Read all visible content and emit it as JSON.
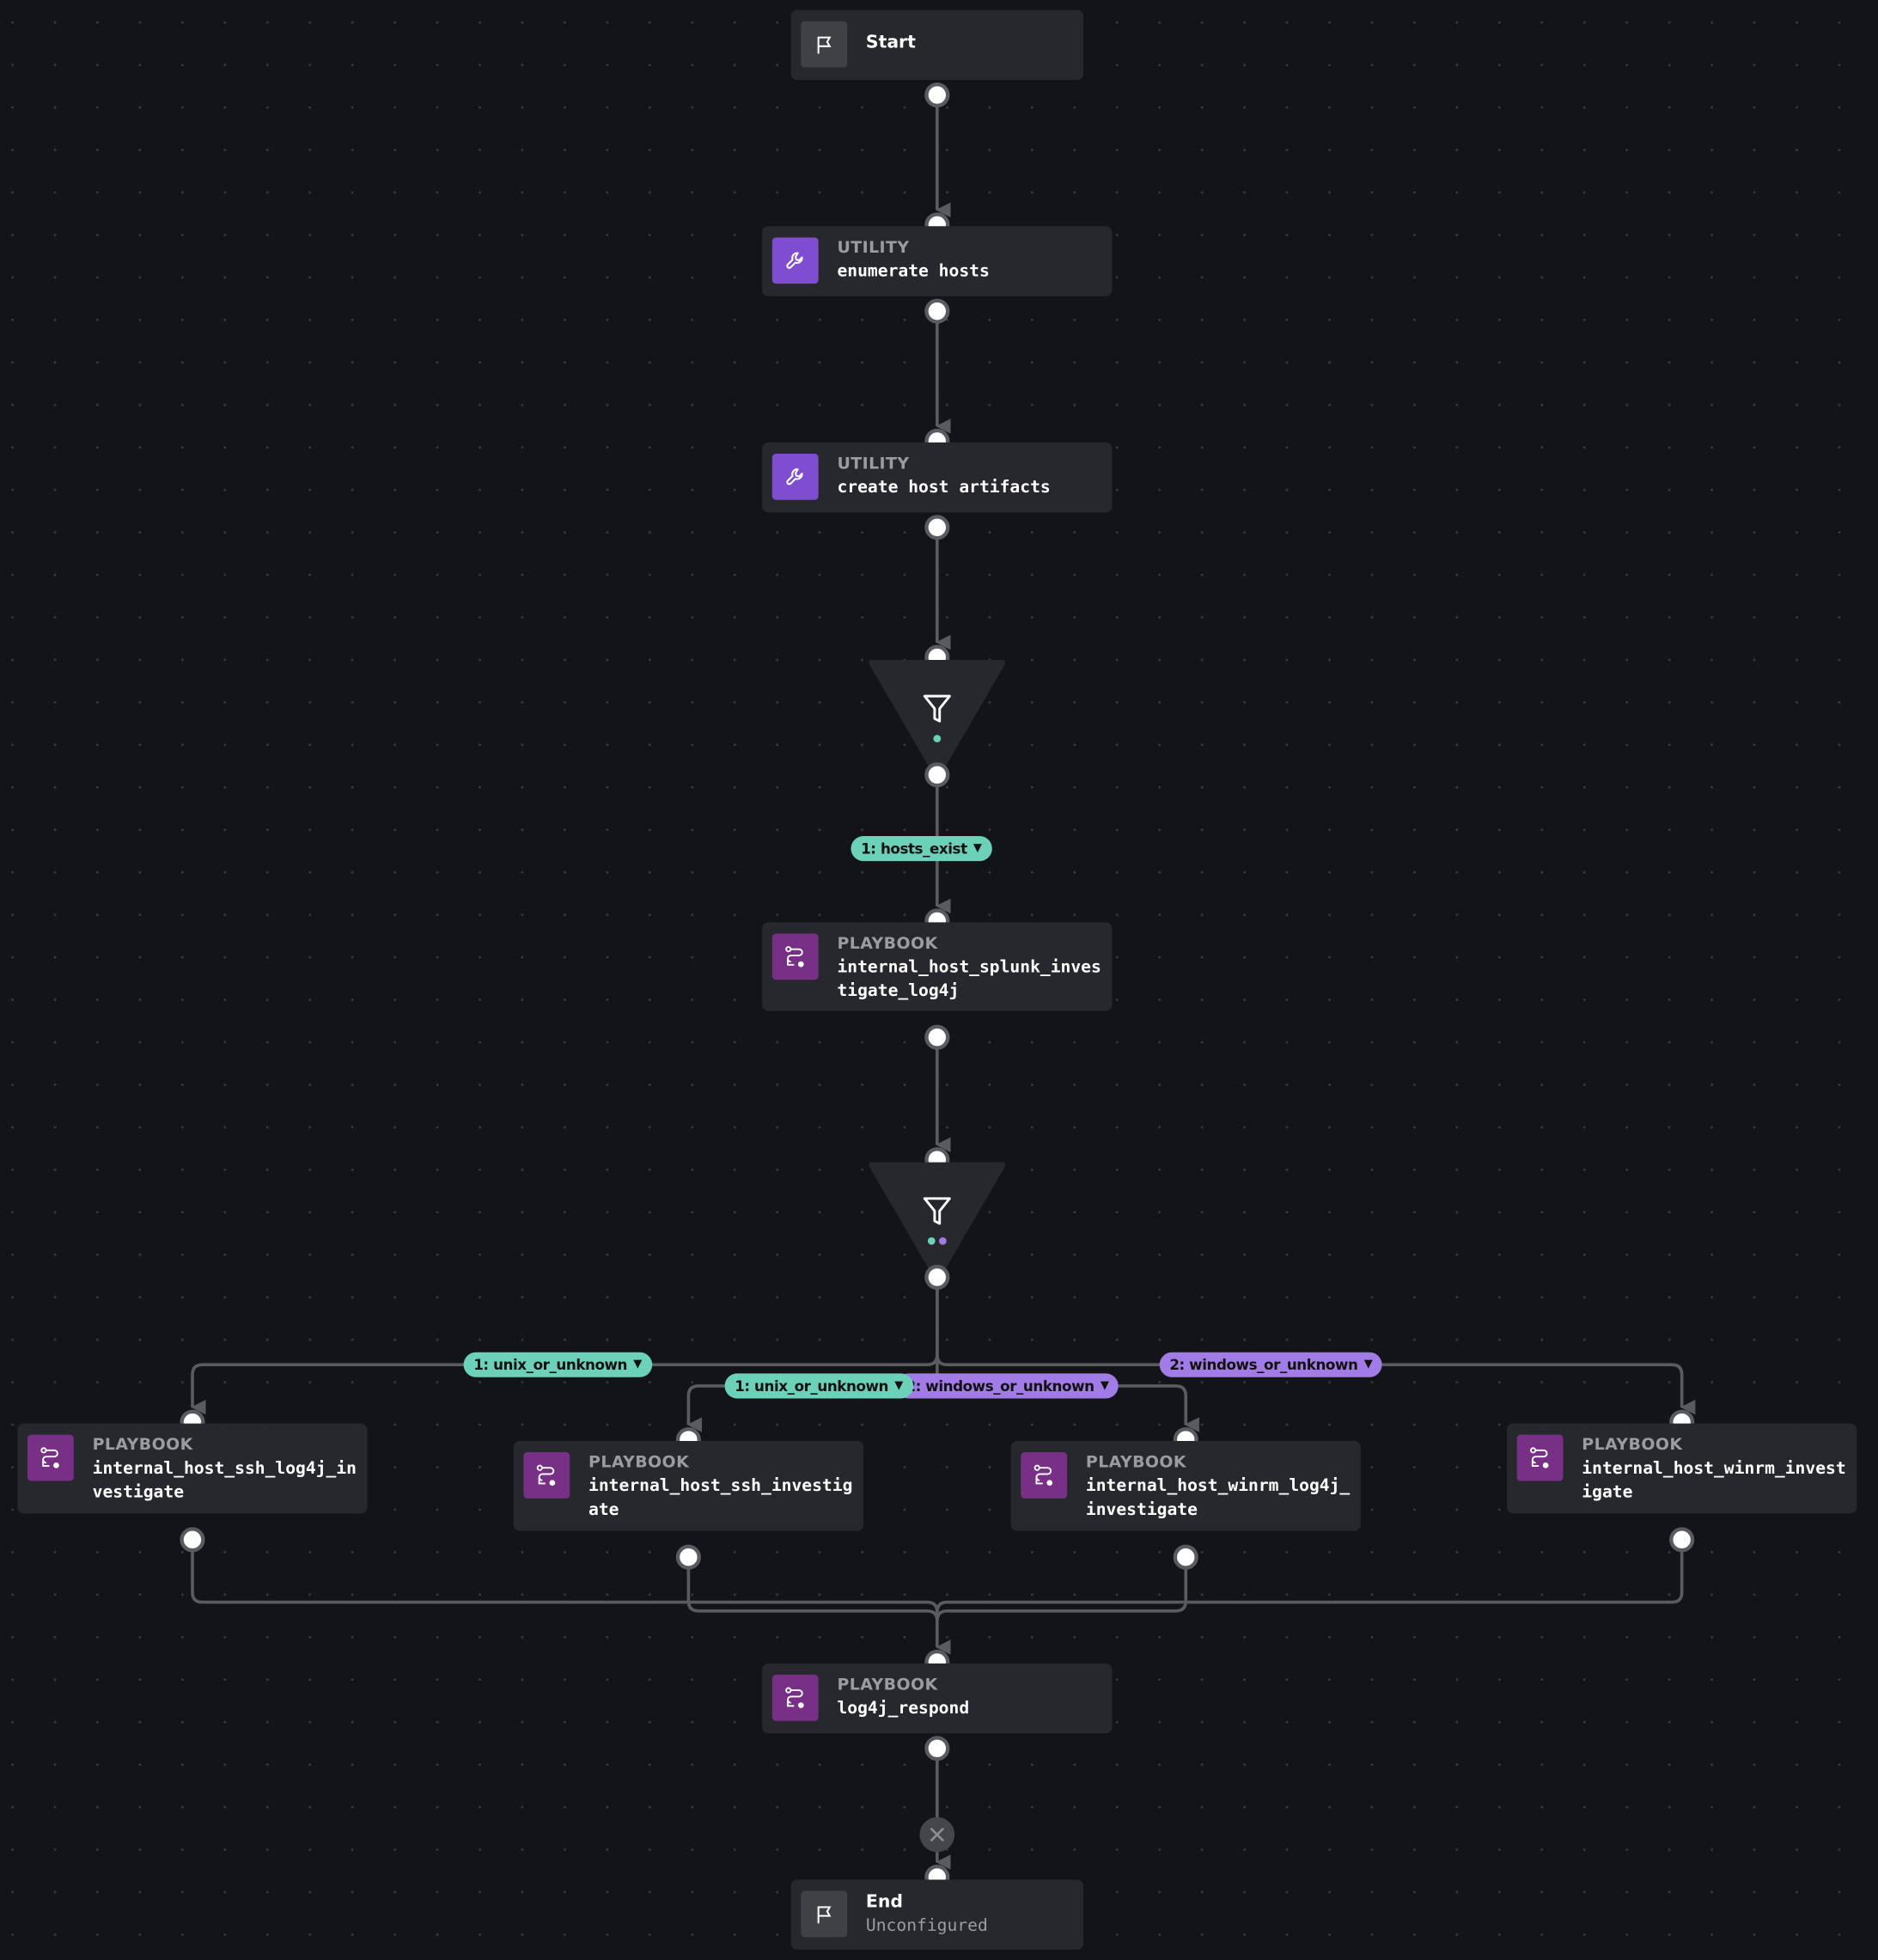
{
  "canvas": {
    "background": "#131418",
    "edge_color": "#5a5b60"
  },
  "colors": {
    "utility": "#7f4ed0",
    "playbook": "#773086",
    "flag_tile": "#404147",
    "node_bg": "#27282d",
    "branch_green": "#6bd1b8",
    "branch_purple": "#a27ce6"
  },
  "nodes": {
    "start": {
      "title": "Start",
      "icon": "flag-icon"
    },
    "enumerate": {
      "kind": "UTILITY",
      "title": "enumerate hosts",
      "icon": "wrench-icon"
    },
    "create_artifacts": {
      "kind": "UTILITY",
      "title": "create host artifacts",
      "icon": "wrench-icon"
    },
    "decision1": {
      "icon": "filter-icon",
      "branches": 1
    },
    "splunk": {
      "kind": "PLAYBOOK",
      "title": "internal_host_splunk_investigate_log4j",
      "icon": "playbook-icon"
    },
    "decision2": {
      "icon": "filter-icon",
      "branches": 2
    },
    "ssh_log4j": {
      "kind": "PLAYBOOK",
      "title": "internal_host_ssh_log4j_investigate",
      "icon": "playbook-icon"
    },
    "ssh_inv": {
      "kind": "PLAYBOOK",
      "title": "internal_host_ssh_investigate",
      "icon": "playbook-icon"
    },
    "winrm_log4j": {
      "kind": "PLAYBOOK",
      "title": "internal_host_winrm_log4j_investigate",
      "icon": "playbook-icon"
    },
    "winrm_inv": {
      "kind": "PLAYBOOK",
      "title": "internal_host_winrm_investigate",
      "icon": "playbook-icon"
    },
    "respond": {
      "kind": "PLAYBOOK",
      "title": "log4j_respond",
      "icon": "playbook-icon"
    },
    "end": {
      "title": "End",
      "subtitle": "Unconfigured",
      "icon": "flag-icon"
    }
  },
  "branch_labels": {
    "hosts_exist": "1: hosts_exist",
    "unix_left": "1: unix_or_unknown",
    "unix_mid": "1: unix_or_unknown",
    "windows_mid": "2: windows_or_unknown",
    "windows_right": "2: windows_or_unknown"
  },
  "caret": "▼"
}
